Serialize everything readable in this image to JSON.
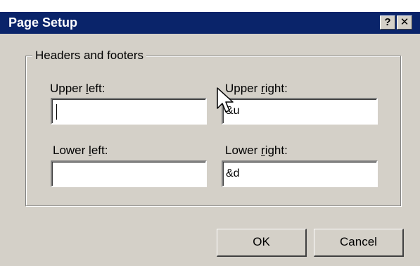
{
  "window": {
    "title": "Page Setup"
  },
  "titlebar": {
    "help_glyph": "?",
    "close_glyph": "✕"
  },
  "group": {
    "label": "Headers and footers"
  },
  "fields": {
    "upper_left": {
      "label_pre": "Upper ",
      "label_key": "l",
      "label_post": "eft:",
      "value": ""
    },
    "upper_right": {
      "label_pre": "Upper ",
      "label_key": "r",
      "label_post": "ight:",
      "value": "&u"
    },
    "lower_left": {
      "label_pre": "Lower ",
      "label_key": "l",
      "label_post": "eft:",
      "value": ""
    },
    "lower_right": {
      "label_pre": "Lower ",
      "label_key": "r",
      "label_post": "ight:",
      "value": "&d"
    }
  },
  "buttons": {
    "ok": "OK",
    "cancel": "Cancel"
  },
  "colors": {
    "titlebar": "#0a246a",
    "face": "#d4d0c8"
  }
}
